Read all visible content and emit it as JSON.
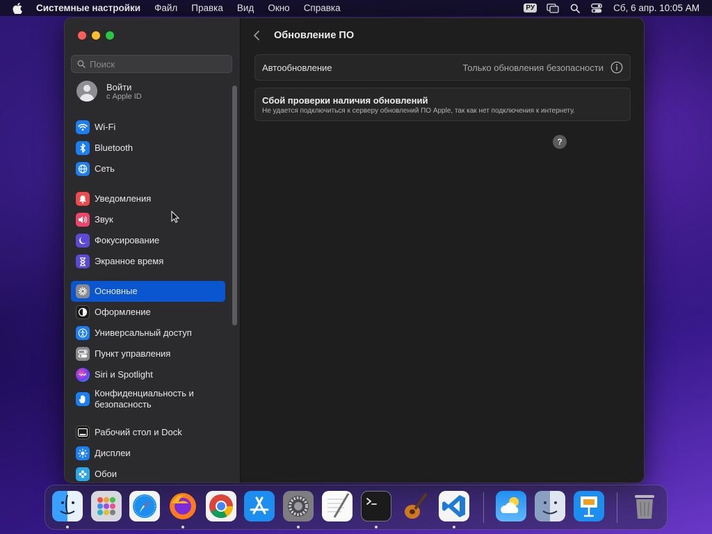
{
  "menubar": {
    "app_name": "Системные настройки",
    "items": [
      "Файл",
      "Правка",
      "Вид",
      "Окно",
      "Справка"
    ],
    "input_lang": "РУ",
    "clock": "Сб, 6 апр.  10:05 AM"
  },
  "sidebar": {
    "search_placeholder": "Поиск",
    "account": {
      "name": "Войти",
      "sub": "с Apple ID"
    },
    "groups": [
      [
        {
          "label": "Wi-Fi",
          "icon": "wifi-icon",
          "color": "#1a7ff5"
        },
        {
          "label": "Bluetooth",
          "icon": "bluetooth-icon",
          "color": "#1a7ff5"
        },
        {
          "label": "Сеть",
          "icon": "globe-icon",
          "color": "#1a7ff5"
        }
      ],
      [
        {
          "label": "Уведомления",
          "icon": "bell-icon",
          "color": "#f04a4a"
        },
        {
          "label": "Звук",
          "icon": "speaker-icon",
          "color": "#f0456b"
        },
        {
          "label": "Фокусирование",
          "icon": "moon-icon",
          "color": "#5b4ad8"
        },
        {
          "label": "Экранное время",
          "icon": "hourglass-icon",
          "color": "#5b4ad8"
        }
      ],
      [
        {
          "label": "Основные",
          "icon": "gear-icon",
          "color": "#8a8a8e",
          "active": true
        },
        {
          "label": "Оформление",
          "icon": "appearance-icon",
          "color": "#1b1b1b"
        },
        {
          "label": "Универсальный доступ",
          "icon": "accessibility-icon",
          "color": "#1a7ff5"
        },
        {
          "label": "Пункт управления",
          "icon": "control-center-icon",
          "color": "#8a8a8e"
        },
        {
          "label": "Siri и Spotlight",
          "icon": "siri-icon",
          "color": "#222222"
        },
        {
          "label": "Конфиденциальность и безопасность",
          "icon": "hand-icon",
          "color": "#1a7ff5"
        }
      ],
      [
        {
          "label": "Рабочий стол и Dock",
          "icon": "dock-icon",
          "color": "#1b1b1b"
        },
        {
          "label": "Дисплеи",
          "icon": "sun-icon",
          "color": "#1a7ff5"
        },
        {
          "label": "Обои",
          "icon": "wallpaper-icon",
          "color": "#2aa7e8"
        }
      ]
    ]
  },
  "main": {
    "title": "Обновление ПО",
    "auto_update": {
      "label": "Автообновление",
      "value": "Только обновления безопасности"
    },
    "error": {
      "title": "Сбой проверки наличия обновлений",
      "message": "Не удается подключиться к серверу обновлений ПО Apple, так как нет подключения к интернету."
    },
    "help": "?"
  },
  "dock": {
    "apps": [
      {
        "name": "finder-icon",
        "running": true
      },
      {
        "name": "launchpad-icon",
        "running": false
      },
      {
        "name": "safari-icon",
        "running": false
      },
      {
        "name": "firefox-icon",
        "running": true
      },
      {
        "name": "chrome-icon",
        "running": false
      },
      {
        "name": "app-store-icon",
        "running": false
      },
      {
        "name": "system-settings-icon",
        "running": true
      },
      {
        "name": "textedit-icon",
        "running": false
      },
      {
        "name": "terminal-icon",
        "running": true
      },
      {
        "name": "garageband-icon",
        "running": false
      },
      {
        "name": "vscode-icon",
        "running": true
      },
      {
        "name": "weather-icon",
        "running": false
      },
      {
        "name": "finder-alt-icon",
        "running": false
      },
      {
        "name": "keynote-icon",
        "running": false
      },
      {
        "name": "trash-icon",
        "running": false
      }
    ]
  }
}
